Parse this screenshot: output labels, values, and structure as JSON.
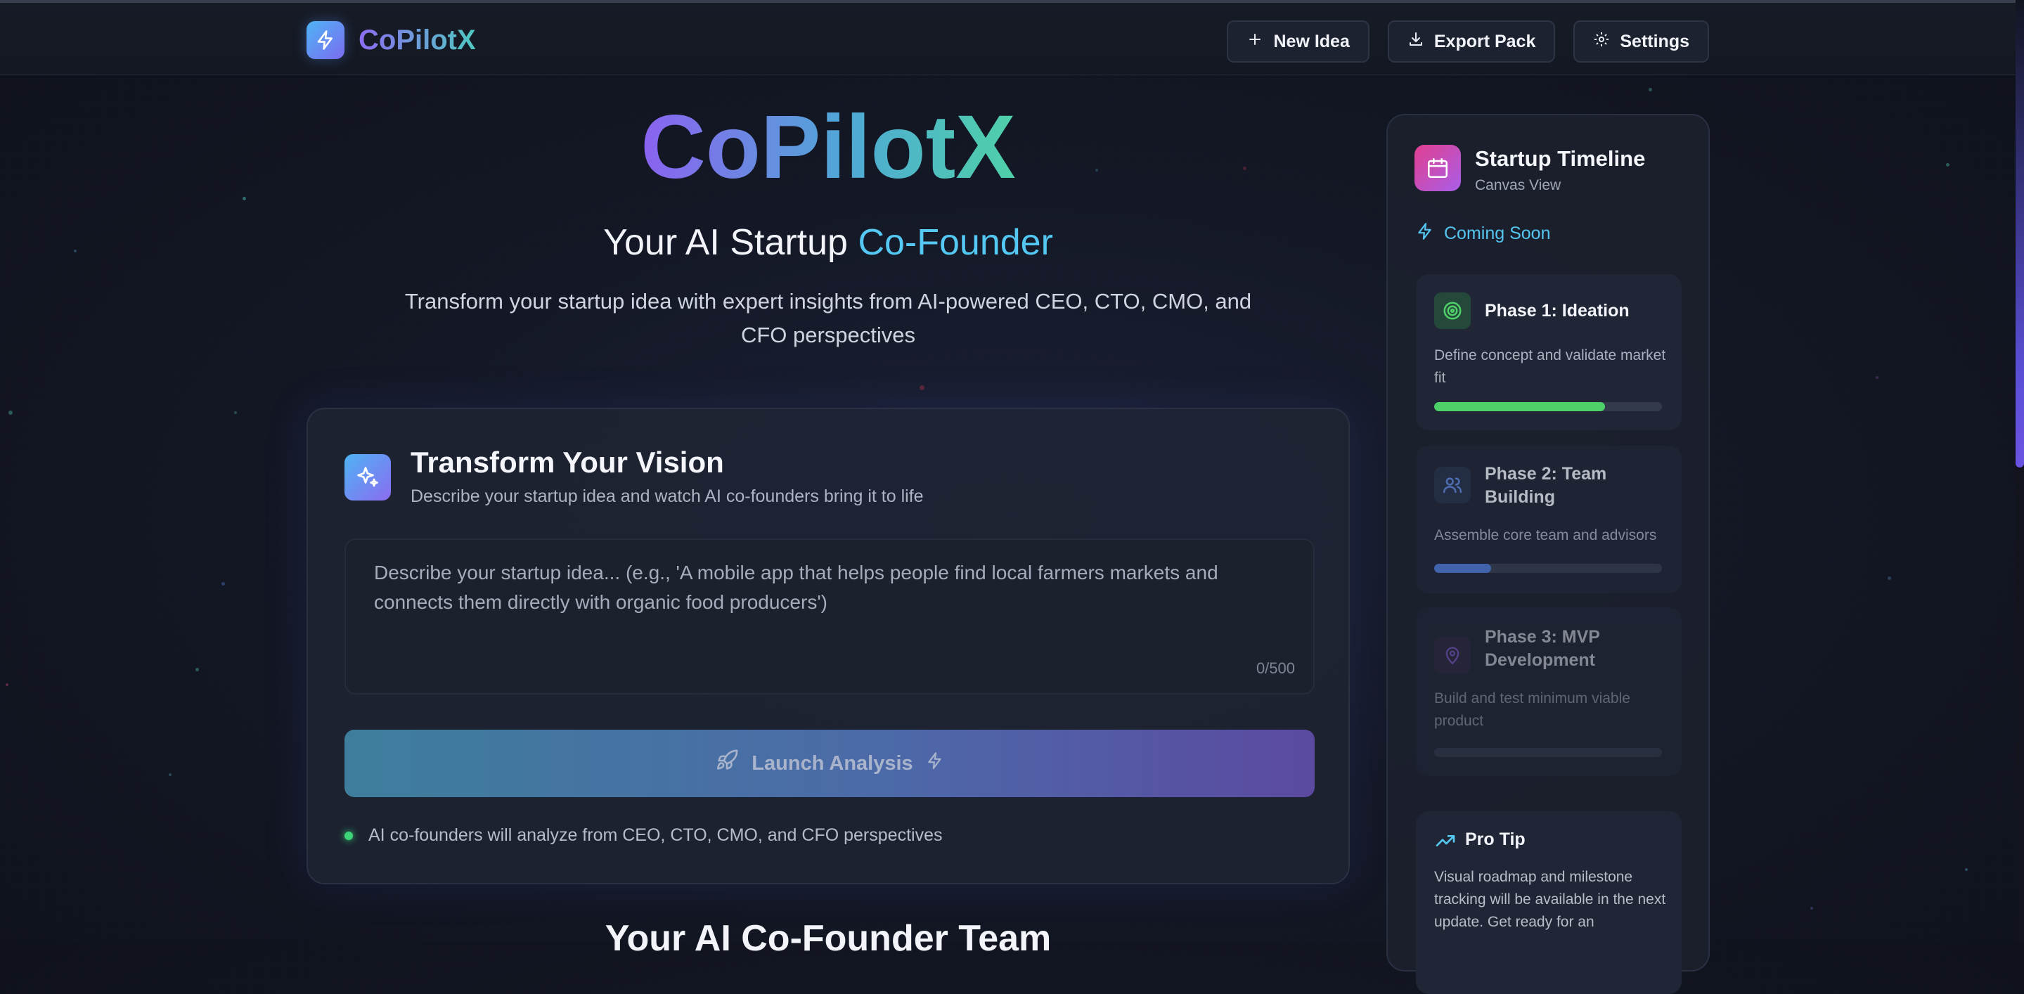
{
  "header": {
    "logo_text": "CoPilotX",
    "buttons": {
      "new_idea": "New Idea",
      "export_pack": "Export Pack",
      "settings": "Settings"
    }
  },
  "hero": {
    "title": "CoPilotX",
    "subtitle_main": "Your AI Startup",
    "subtitle_accent": "Co-Founder",
    "description": "Transform your startup idea with expert insights from AI-powered CEO, CTO, CMO, and CFO perspectives"
  },
  "vision_card": {
    "title": "Transform Your Vision",
    "subtitle": "Describe your startup idea and watch AI co-founders bring it to life",
    "input": {
      "value": "",
      "placeholder": "Describe your startup idea... (e.g., 'A mobile app that helps people find local farmers markets and connects them directly with organic food producers')",
      "counter": "0/500"
    },
    "launch_button": "Launch Analysis",
    "note": "AI co-founders will analyze from CEO, CTO, CMO, and CFO perspectives"
  },
  "team_section": {
    "title": "Your AI Co-Founder Team"
  },
  "sidebar": {
    "title": "Startup Timeline",
    "subtitle": "Canvas View",
    "coming_soon": "Coming Soon",
    "phases": [
      {
        "title": "Phase 1: Ideation",
        "description": "Define concept and validate market fit",
        "progress": 0.75,
        "color": "#4fd16a",
        "icon": "target-icon"
      },
      {
        "title": "Phase 2: Team Building",
        "description": "Assemble core team and advisors",
        "progress": 0.25,
        "color": "#4a72c9",
        "icon": "users-icon"
      },
      {
        "title": "Phase 3: MVP Development",
        "description": "Build and test minimum viable product",
        "progress": 0.0,
        "color": "#7a58c9",
        "icon": "map-pin-icon"
      }
    ],
    "pro_tip": {
      "title": "Pro Tip",
      "text": "Visual roadmap and milestone tracking will be available in the next update. Get ready for an"
    }
  },
  "colors": {
    "accent_cyan": "#54c8f2",
    "accent_purple": "#8b62f0",
    "status_green": "#3fd47a"
  }
}
